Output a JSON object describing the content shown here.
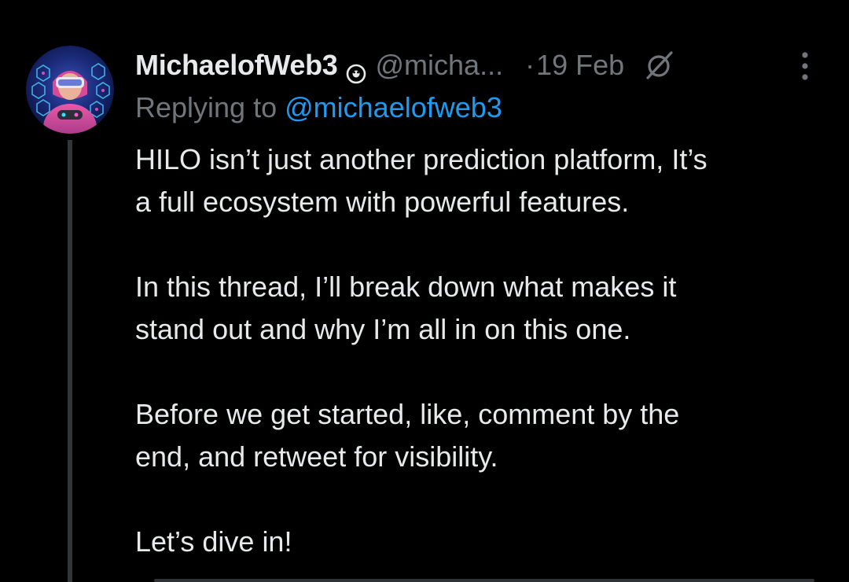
{
  "tweet": {
    "author": {
      "display_name": "MichaelofWeb3",
      "handle": "@micha...",
      "avatar_icon": "avatar-vr-gamer",
      "badge_icon": "verified-circle-icon"
    },
    "separator": "·",
    "date": "19 Feb",
    "grok_icon": "grok-slash-icon",
    "more_icon": "vertical-ellipsis-icon",
    "reply": {
      "prefix": "Replying to",
      "mention": "@michaelofweb3"
    },
    "body": {
      "line1": "HILO isn’t just another prediction platform, It’s",
      "line2": "a full ecosystem with powerful features.",
      "line3": "In this thread, I’ll break down what makes it",
      "line4": "stand out and why I’m all in on this one.",
      "line5": "Before we get started, like, comment by the",
      "line6": "end, and retweet for visibility.",
      "line7": "Let’s dive in!"
    }
  },
  "colors": {
    "background": "#000000",
    "text": "#e7e9ea",
    "secondary": "#71767b",
    "link": "#1d9bf0",
    "thread_line": "#333639"
  }
}
